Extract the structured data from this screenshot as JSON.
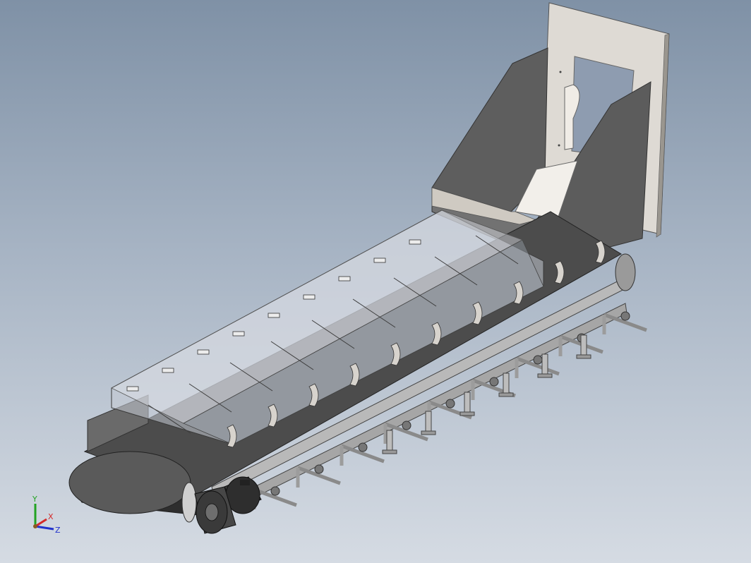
{
  "viewport": {
    "background_top": "#7f91a6",
    "background_bottom": "#d5dbe3"
  },
  "model": {
    "description_icon": "conveyor-assembly-3d-model",
    "colors": {
      "hopper_wall": "#5f5f5f",
      "hopper_plate": "#dedad4",
      "belt": "#4c4c4c",
      "cover_glass": "#b8bec6",
      "frame": "#a9a9a9",
      "motor": "#3d3d3d"
    }
  },
  "triad": {
    "x_label": "X",
    "y_label": "Y",
    "z_label": "Z",
    "x_color": "#d42a2a",
    "y_color": "#22a322",
    "z_color": "#2233cc"
  }
}
